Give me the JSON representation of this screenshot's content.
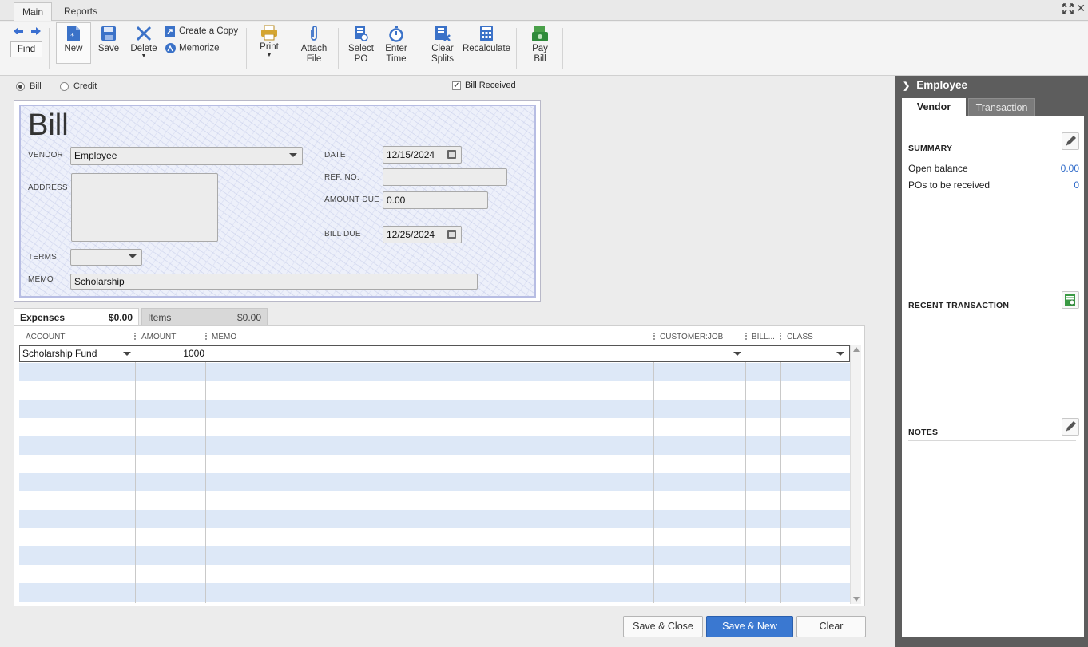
{
  "tabs": {
    "main": "Main",
    "reports": "Reports"
  },
  "toolbar": {
    "find": "Find",
    "new": "New",
    "save": "Save",
    "delete": "Delete",
    "create_copy": "Create a Copy",
    "memorize": "Memorize",
    "print": "Print",
    "attach_1": "Attach",
    "attach_2": "File",
    "select_1": "Select",
    "select_2": "PO",
    "enter_1": "Enter",
    "enter_2": "Time",
    "clear_1": "Clear",
    "clear_2": "Splits",
    "recalculate": "Recalculate",
    "pay_1": "Pay",
    "pay_2": "Bill"
  },
  "type": {
    "bill": "Bill",
    "credit": "Credit",
    "bill_received": "Bill Received"
  },
  "form": {
    "title": "Bill",
    "vendor_label": "VENDOR",
    "vendor": "Employee",
    "address_label": "ADDRESS",
    "terms_label": "TERMS",
    "memo_label": "MEMO",
    "memo": "Scholarship",
    "date_label": "DATE",
    "date": "12/15/2024",
    "ref_label": "REF. NO.",
    "amount_due_label": "AMOUNT DUE",
    "amount_due": "0.00",
    "bill_due_label": "BILL DUE",
    "bill_due": "12/25/2024"
  },
  "line_tabs": {
    "expenses": "Expenses",
    "expenses_amt": "$0.00",
    "items": "Items",
    "items_amt": "$0.00"
  },
  "grid": {
    "headers": {
      "account": "ACCOUNT",
      "amount": "AMOUNT",
      "memo": "MEMO",
      "customer": "CUSTOMER:JOB",
      "bill": "BILL...",
      "class": "CLASS"
    },
    "row1": {
      "account": "Scholarship Fund",
      "amount": "1000"
    }
  },
  "buttons": {
    "save_close": "Save & Close",
    "save_new": "Save & New",
    "clear": "Clear"
  },
  "panel": {
    "title": "Employee",
    "tab_vendor": "Vendor",
    "tab_transaction": "Transaction",
    "summary": "SUMMARY",
    "open_balance_label": "Open balance",
    "open_balance": "0.00",
    "pos_label": "POs to be received",
    "pos": "0",
    "recent": "RECENT TRANSACTION",
    "notes": "NOTES"
  }
}
